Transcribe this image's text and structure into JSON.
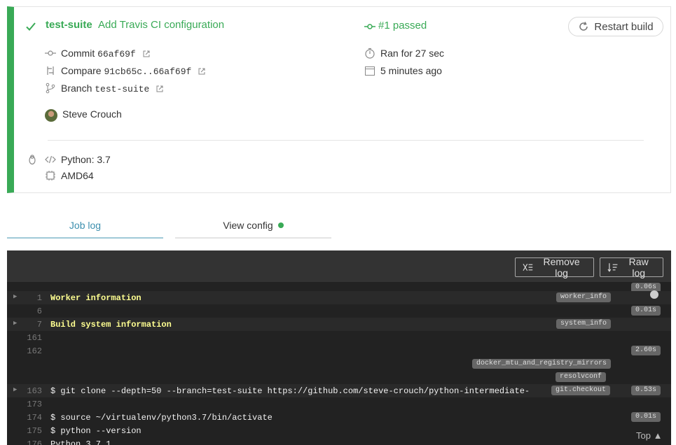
{
  "build": {
    "repo": "test-suite",
    "message": "Add Travis CI configuration",
    "status": "#1 passed",
    "restart_label": "Restart build",
    "commit_label": "Commit",
    "commit_hash": "66af69f",
    "compare_label": "Compare",
    "compare_range": "91cb65c..66af69f",
    "branch_label": "Branch",
    "branch_name": "test-suite",
    "duration": "Ran for 27 sec",
    "finished": "5 minutes ago",
    "author": "Steve Crouch",
    "language": "Python: 3.7",
    "arch": "AMD64",
    "status_color": "#39aa56"
  },
  "tabs": {
    "job_log": "Job log",
    "view_config": "View config"
  },
  "log": {
    "remove_label": "Remove log",
    "raw_label": "Raw log",
    "top_label": "Top",
    "rows": [
      {
        "ln": "1",
        "text": "Worker information",
        "tag": "worker_info"
      },
      {
        "ln": "6",
        "time": "0.01s"
      },
      {
        "ln": "7",
        "text": "Build system information",
        "tag": "system_info"
      },
      {
        "ln": "161"
      },
      {
        "ln": "162",
        "time": "2.60s"
      },
      {
        "ln": "163",
        "text": "$ git clone --depth=50 --branch=test-suite https://github.com/steve-crouch/python-intermediate-",
        "tag": "git.checkout",
        "time": "0.53s"
      },
      {
        "ln": "173"
      },
      {
        "ln": "174",
        "text": "$ source ~/virtualenv/python3.7/bin/activate",
        "time": "0.01s"
      },
      {
        "ln": "175",
        "text": "$ python --version"
      },
      {
        "ln": "176",
        "text": "Python 3.7.1"
      }
    ],
    "time_top": "0.06s",
    "tag_docker": "docker_mtu_and_registry_mirrors",
    "tag_resolv": "resolvconf"
  }
}
